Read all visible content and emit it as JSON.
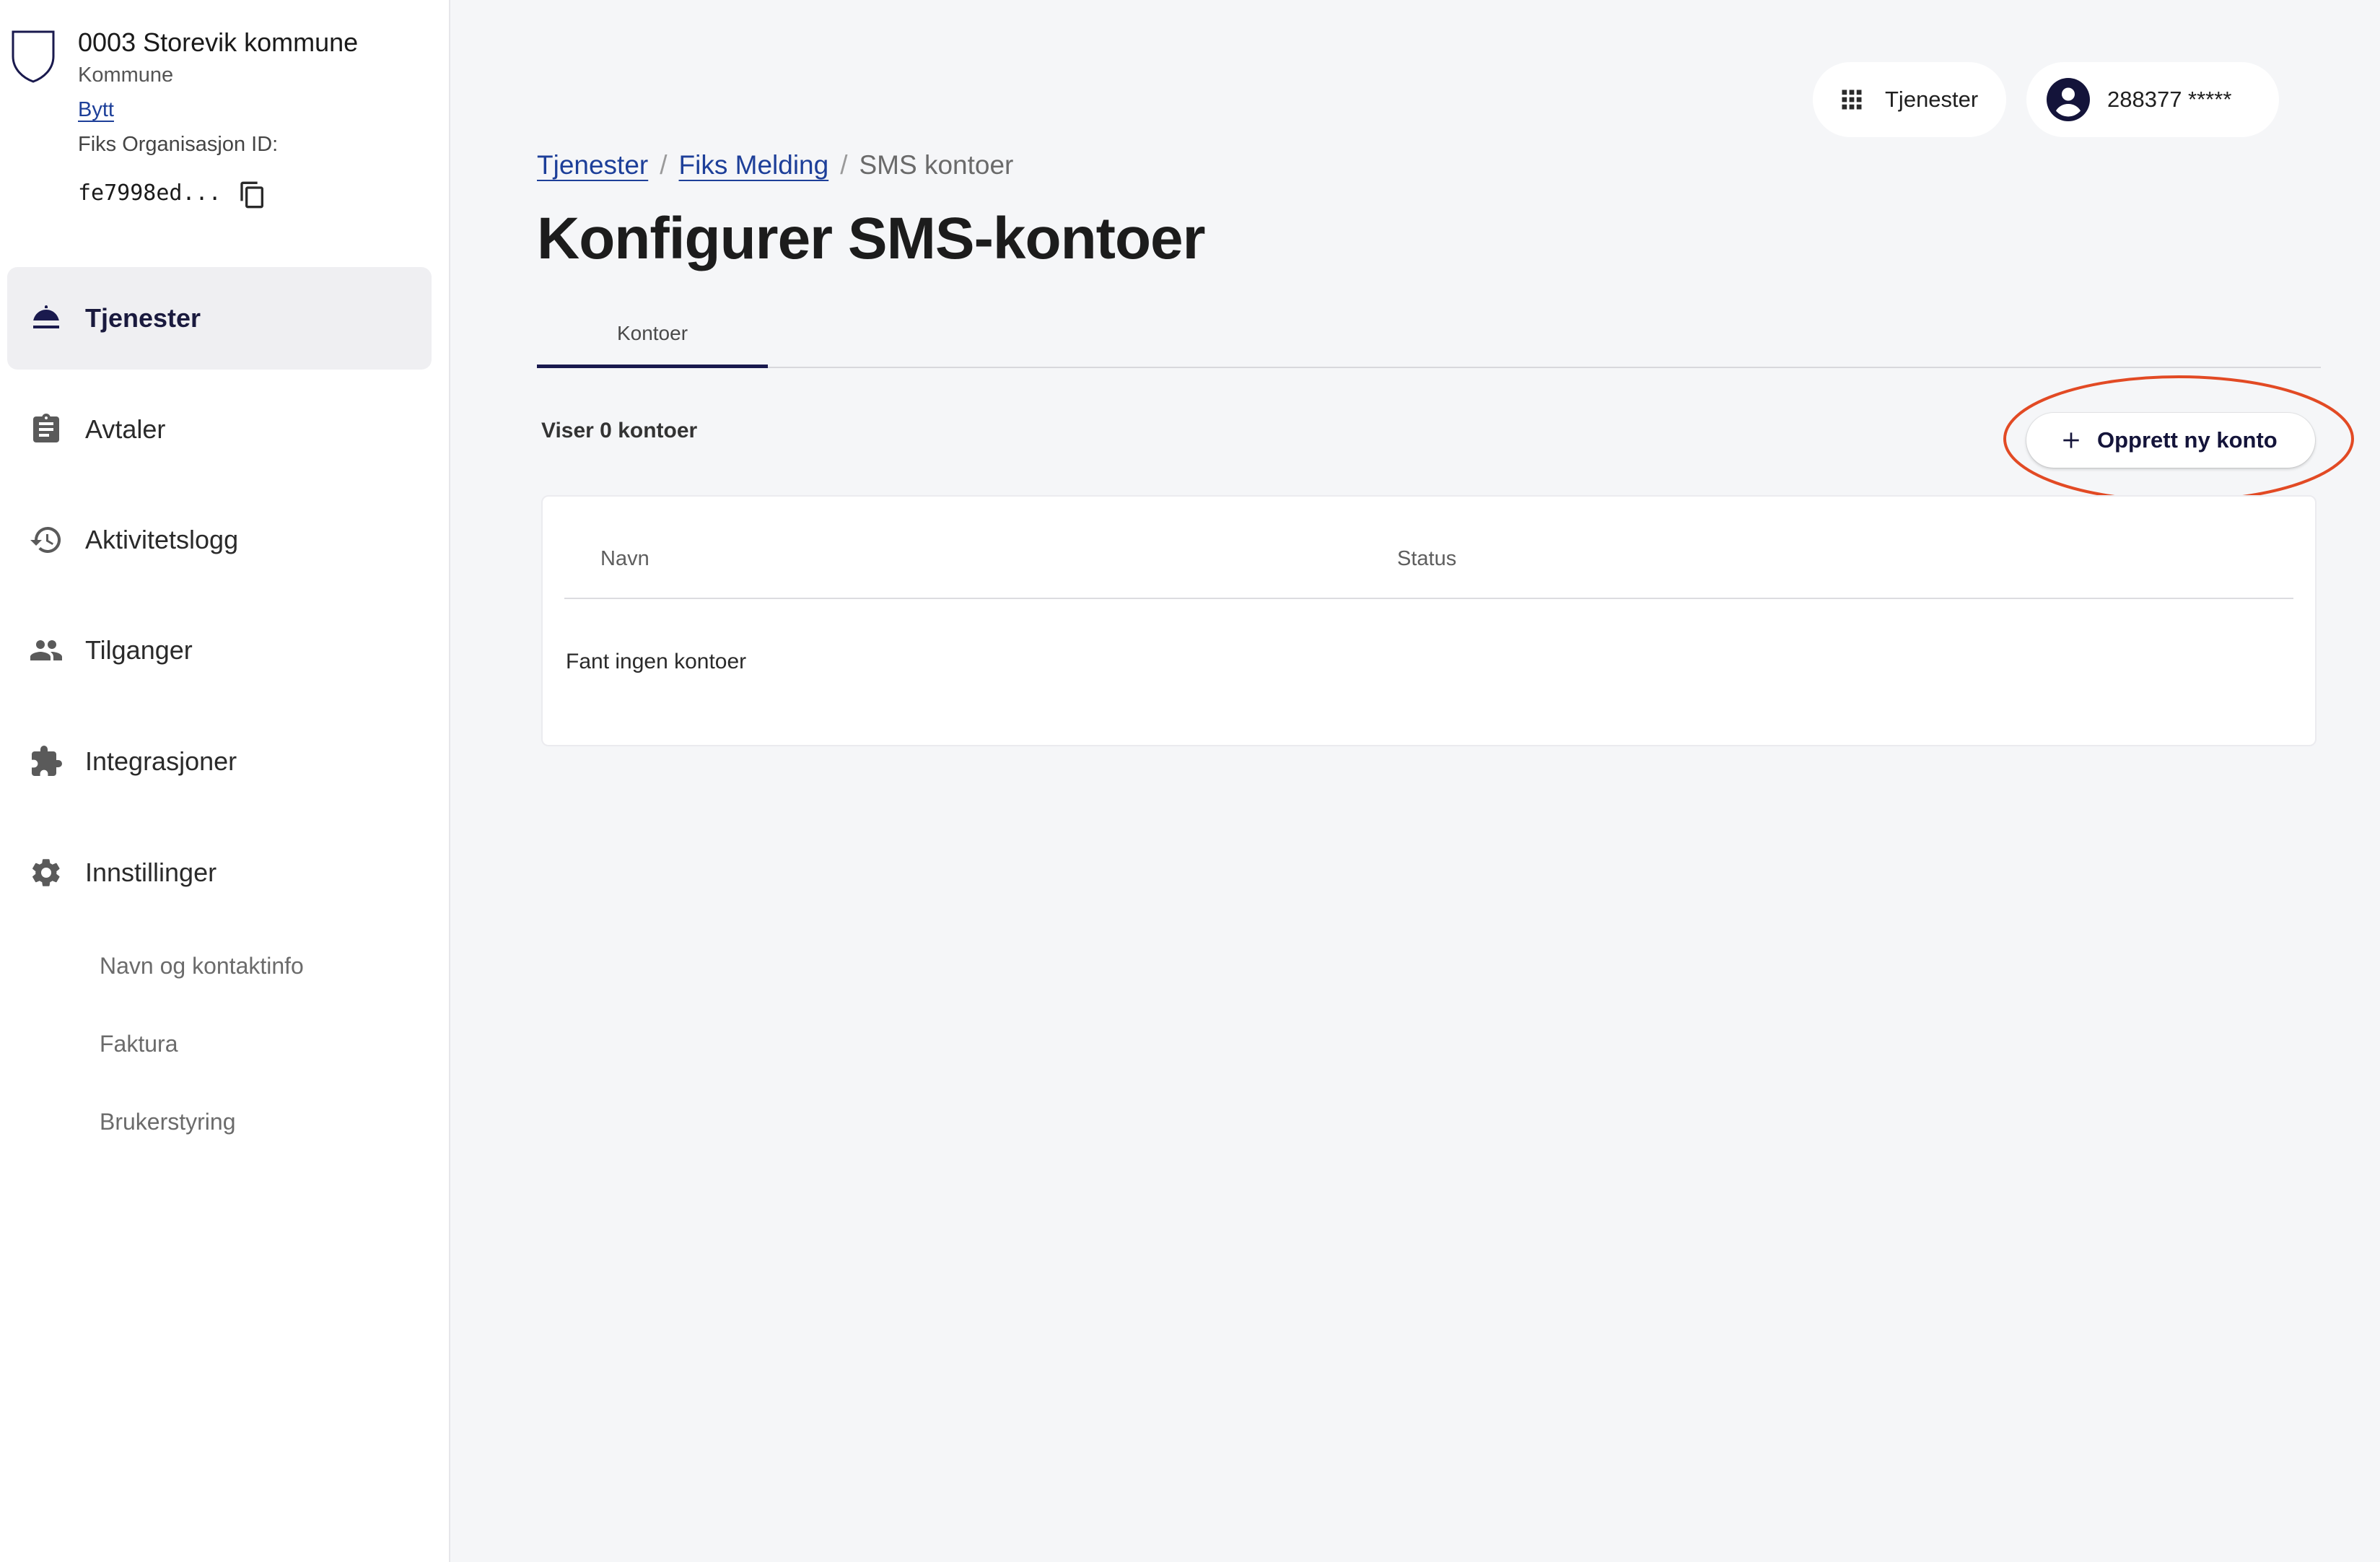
{
  "org": {
    "name": "0003 Storevik kommune",
    "type": "Kommune",
    "switch_label": "Bytt",
    "id_label": "Fiks Organisasjon ID:",
    "id_value": "fe7998ed..."
  },
  "sidebar": {
    "items": [
      {
        "label": "Tjenester",
        "icon": "service-bell-icon",
        "active": true
      },
      {
        "label": "Avtaler",
        "icon": "clipboard-icon",
        "active": false
      },
      {
        "label": "Aktivitetslogg",
        "icon": "history-icon",
        "active": false
      },
      {
        "label": "Tilganger",
        "icon": "people-icon",
        "active": false
      },
      {
        "label": "Integrasjoner",
        "icon": "puzzle-icon",
        "active": false
      },
      {
        "label": "Innstillinger",
        "icon": "gear-icon",
        "active": false
      }
    ],
    "subitems": [
      {
        "label": "Navn og kontaktinfo"
      },
      {
        "label": "Faktura"
      },
      {
        "label": "Brukerstyring"
      }
    ]
  },
  "header": {
    "services_label": "Tjenester",
    "services_icon": "apps-grid-icon",
    "user_label": "288377 *****",
    "user_icon": "account-circle-icon"
  },
  "breadcrumb": {
    "items": [
      "Tjenester",
      "Fiks Melding"
    ],
    "current": "SMS kontoer",
    "separator": "/"
  },
  "page": {
    "title": "Konfigurer SMS-kontoer",
    "tabs": [
      {
        "label": "Kontoer",
        "active": true
      }
    ],
    "count_text": "Viser 0 kontoer",
    "create_button_label": "Opprett ny konto"
  },
  "table": {
    "columns": [
      "Navn",
      "Status"
    ],
    "rows": [],
    "empty_text": "Fant ingen kontoer"
  },
  "colors": {
    "link": "#1d3f99",
    "active_tab": "#1a1a4e",
    "highlight_ring": "#e24a24",
    "sidebar_active_bg": "#efeff2",
    "page_bg": "#f5f6f8"
  }
}
